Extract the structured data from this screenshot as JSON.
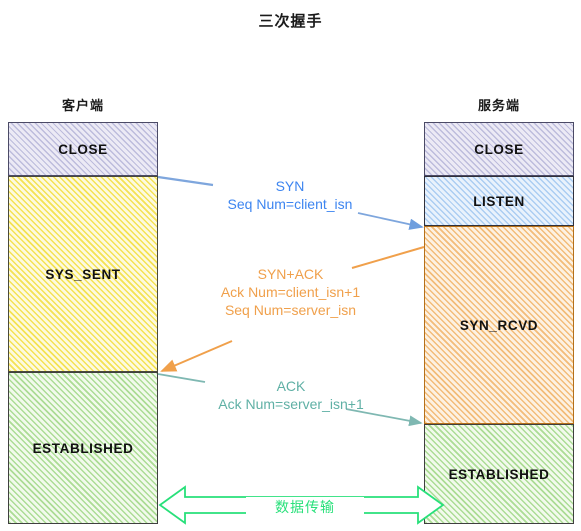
{
  "title": "三次握手",
  "columns": {
    "client": {
      "label": "客户端",
      "states": [
        {
          "name": "CLOSE",
          "color": "#eceaf5"
        },
        {
          "name": "SYS_SENT",
          "color": "#fdfadf"
        },
        {
          "name": "ESTABLISHED",
          "color": "#f2faec"
        }
      ]
    },
    "server": {
      "label": "服务端",
      "states": [
        {
          "name": "CLOSE",
          "color": "#eceaf5"
        },
        {
          "name": "LISTEN",
          "color": "#e9f2fc"
        },
        {
          "name": "SYN_RCVD",
          "color": "#fdf1e2"
        },
        {
          "name": "ESTABLISHED",
          "color": "#f2faec"
        }
      ]
    }
  },
  "messages": [
    {
      "id": "syn",
      "direction": "client-to-server",
      "color": "#3d85f0",
      "lines": [
        "SYN",
        "Seq Num=client_isn"
      ]
    },
    {
      "id": "syn-ack",
      "direction": "server-to-client",
      "color": "#f0a04b",
      "lines": [
        "SYN+ACK",
        "Ack Num=client_isn+1",
        "Seq Num=server_isn"
      ]
    },
    {
      "id": "ack",
      "direction": "client-to-server",
      "color": "#5fb0a5",
      "lines": [
        "ACK",
        "Ack Num=server_isn+1"
      ]
    }
  ],
  "data_transfer": {
    "label": "数据传输",
    "color": "#28e07a",
    "direction": "bidirectional"
  }
}
